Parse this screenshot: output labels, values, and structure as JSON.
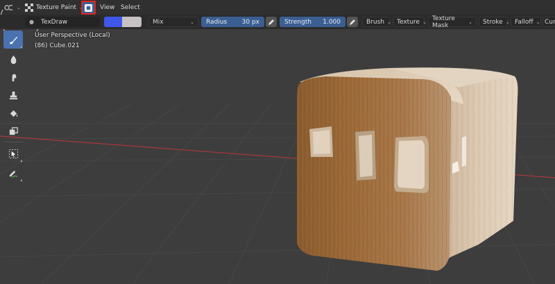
{
  "header": {
    "mode_label": "Texture Paint",
    "menus": [
      "View",
      "Select"
    ]
  },
  "tool_header": {
    "brush_name": "TexDraw",
    "primary_color": "#3e57e8",
    "secondary_color": "#c8c1c4",
    "blend_mode": "Mix",
    "radius_label": "Radius",
    "radius_value": "30 px",
    "strength_label": "Strength",
    "strength_value": "1.000",
    "popovers": [
      "Brush",
      "Texture",
      "Texture Mask",
      "Stroke",
      "Falloff",
      "Curs"
    ]
  },
  "viewport": {
    "perspective_label": "User Perspective (Local)",
    "object_label": "(86) Cube.021"
  },
  "toolbar": {
    "tools": [
      "draw-tool",
      "soften-tool",
      "smear-tool",
      "clone-tool",
      "fill-tool",
      "mask-tool",
      "select-tool",
      "annotate-tool"
    ]
  },
  "colors": {
    "accent": "#4a72b0",
    "slider": "#3b5f92",
    "highlight_box": "#e0241e",
    "x_axis": "#a8383b"
  }
}
